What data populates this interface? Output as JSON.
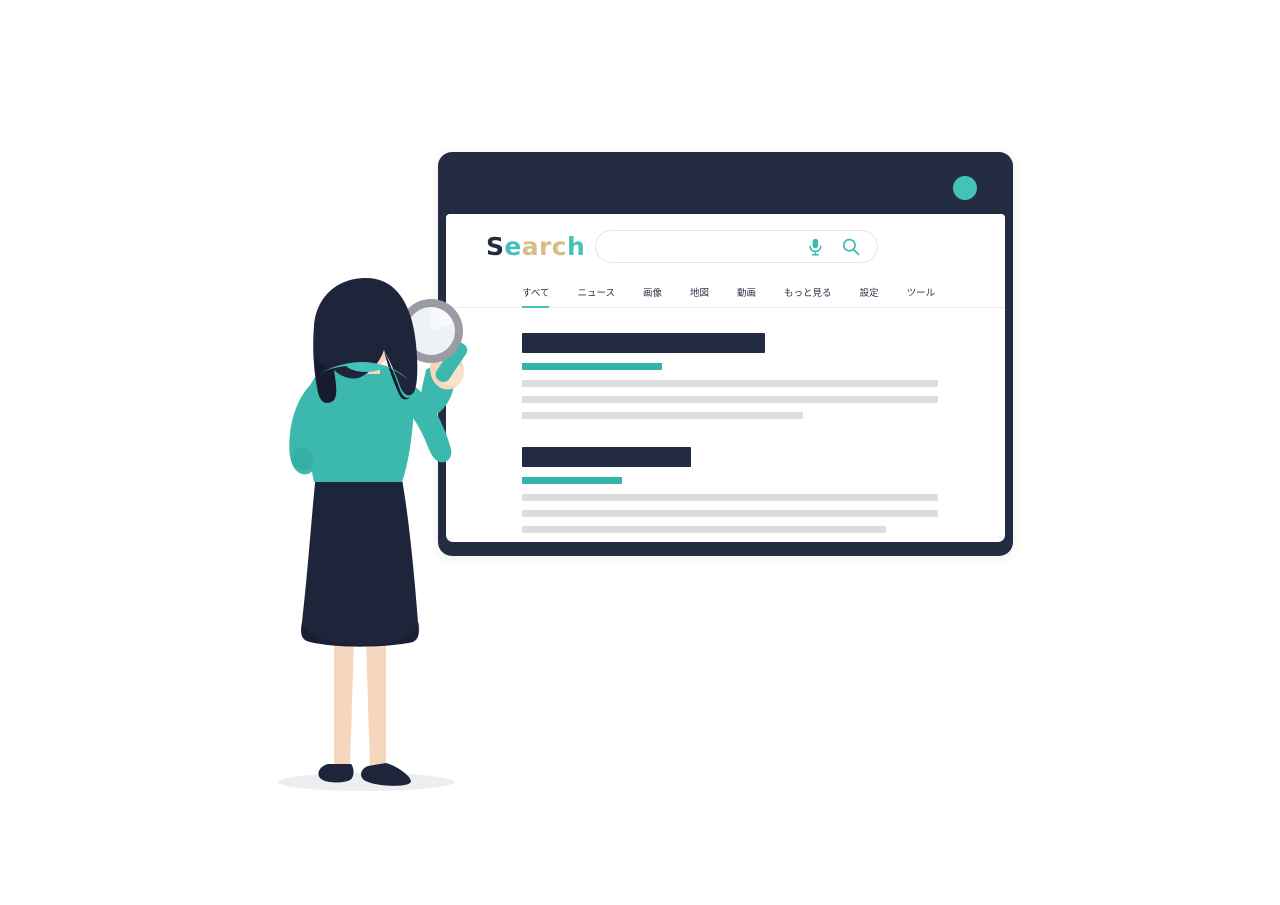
{
  "window": {
    "dot_label": "window-control",
    "dot_color": "#45c2b8",
    "frame_color": "#242c41"
  },
  "brand": {
    "text": "Search",
    "letters": [
      {
        "char": "S",
        "color": "#242c41"
      },
      {
        "char": "e",
        "color": "#45c2b8"
      },
      {
        "char": "a",
        "color": "#d6bd8b"
      },
      {
        "char": "r",
        "color": "#d6bd8b"
      },
      {
        "char": "c",
        "color": "#d6bd8b"
      },
      {
        "char": "h",
        "color": "#45c2b8"
      }
    ]
  },
  "search": {
    "value": "",
    "placeholder": "",
    "mic_icon": "microphone-icon",
    "search_icon": "magnifier-icon",
    "icon_color": "#3bb9ae"
  },
  "tabs": [
    {
      "label": "すべて",
      "active": true
    },
    {
      "label": "ニュース",
      "active": false
    },
    {
      "label": "画像",
      "active": false
    },
    {
      "label": "地図",
      "active": false
    },
    {
      "label": "動画",
      "active": false
    },
    {
      "label": "もっと見る",
      "active": false
    },
    {
      "label": "設定",
      "active": false
    },
    {
      "label": "ツール",
      "active": false
    }
  ],
  "results": [
    {
      "title_width": 243,
      "url_width": 140,
      "lines": [
        416,
        416,
        281
      ],
      "title_color": "#242c41",
      "url_color": "#30b5ab",
      "line_color": "#dddddd"
    },
    {
      "title_width": 169,
      "url_width": 100,
      "lines": [
        416,
        416,
        364
      ],
      "title_color": "#242c41",
      "url_color": "#30b5ab",
      "line_color": "#dddddd"
    }
  ],
  "illustration": {
    "name": "woman-with-magnifying-glass",
    "hair_color": "#1e2439",
    "sweater_color": "#3bb9ae",
    "skirt_color": "#1e2439",
    "skin_color": "#f6d7bd",
    "shoe_color": "#1e2439",
    "magnifier_rim_color": "#9a9ba4",
    "magnifier_lens_color": "#eef1f5",
    "magnifier_handle_color": "#3bb9ae",
    "shadow_color": "#eceef2"
  }
}
